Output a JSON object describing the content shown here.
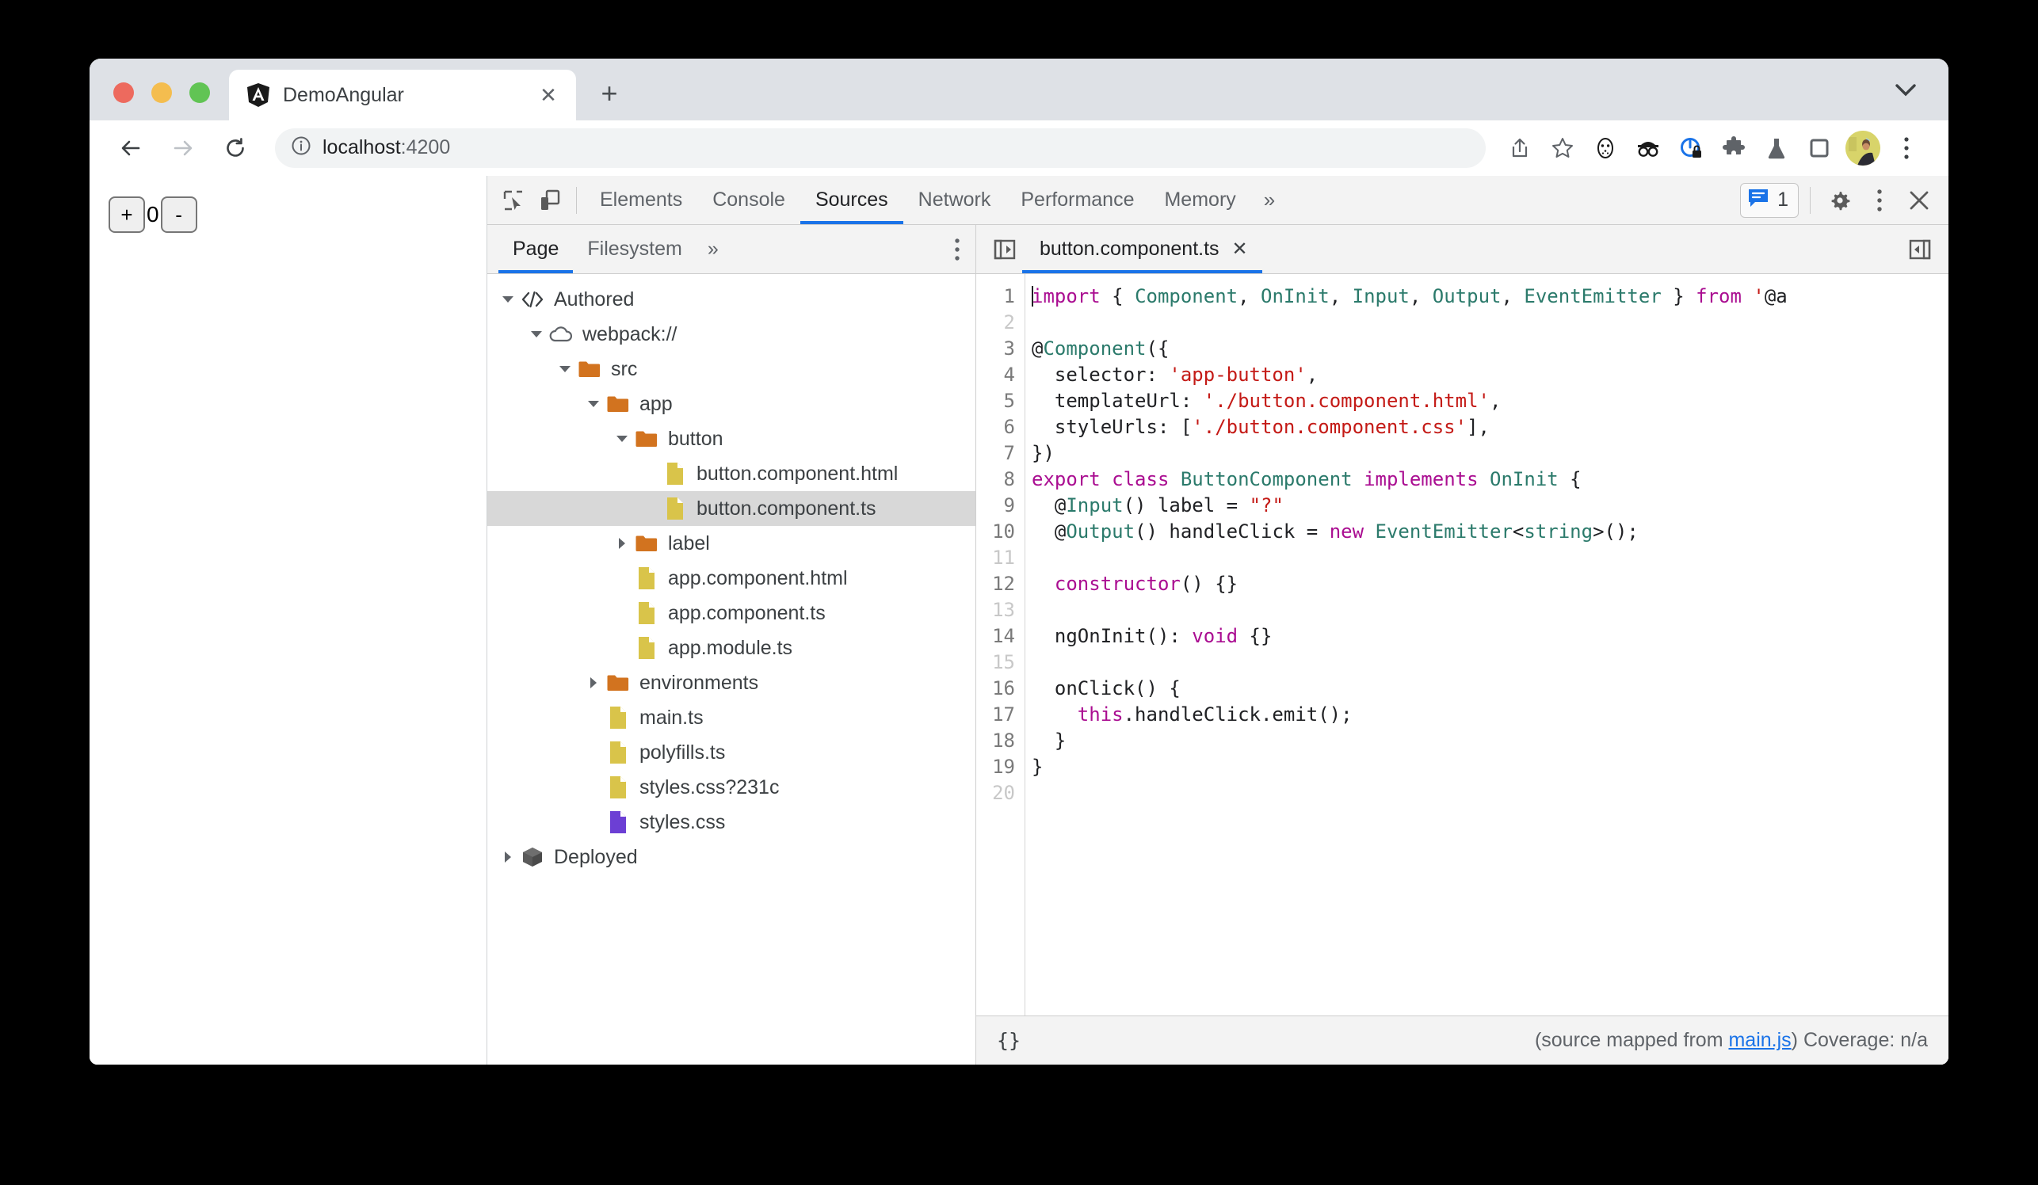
{
  "browser": {
    "tab": {
      "title": "DemoAngular",
      "favicon": "angular-icon",
      "close_label": "✕"
    },
    "new_tab_label": "+",
    "window_chevron": "chevron-down-icon",
    "nav": {
      "back": "←",
      "forward": "→",
      "reload": "⟳"
    },
    "omnibox": {
      "info_icon": "info-circle-icon",
      "url_host": "localhost",
      "url_port": ":4200"
    },
    "toolbar_icons": [
      "share-icon",
      "bookmark-star-icon",
      "mask-extension-icon",
      "incognito-glasses-extension-icon",
      "privacy-lock-extension-icon",
      "extensions-puzzle-icon",
      "flask-experiments-icon",
      "side-panel-icon"
    ],
    "avatar": "profile-avatar",
    "menu_icon": "three-dot-menu-icon"
  },
  "page": {
    "increment_label": "+",
    "counter_value": "0",
    "decrement_label": "-"
  },
  "devtools": {
    "inspect_icon": "inspect-element-icon",
    "device_icon": "device-toolbar-icon",
    "tabs": [
      {
        "label": "Elements",
        "active": false
      },
      {
        "label": "Console",
        "active": false
      },
      {
        "label": "Sources",
        "active": true
      },
      {
        "label": "Network",
        "active": false
      },
      {
        "label": "Performance",
        "active": false
      },
      {
        "label": "Memory",
        "active": false
      }
    ],
    "more_tabs_label": "»",
    "message_count": "1",
    "message_icon": "console-message-icon",
    "settings_icon": "gear-icon",
    "kebab_icon": "three-dot-menu-icon",
    "close_icon": "close-icon",
    "navigator": {
      "tabs": [
        {
          "label": "Page",
          "active": true
        },
        {
          "label": "Filesystem",
          "active": false
        }
      ],
      "more_label": "»",
      "kebab_icon": "three-dot-menu-icon",
      "tree": [
        {
          "label": "Authored",
          "icon": "code-brackets-icon",
          "depth": 0,
          "caret": "down",
          "selected": false
        },
        {
          "label": "webpack://",
          "icon": "cloud-icon",
          "depth": 1,
          "caret": "down",
          "selected": false
        },
        {
          "label": "src",
          "icon": "folder-icon",
          "depth": 2,
          "caret": "down",
          "selected": false
        },
        {
          "label": "app",
          "icon": "folder-icon",
          "depth": 3,
          "caret": "down",
          "selected": false
        },
        {
          "label": "button",
          "icon": "folder-icon",
          "depth": 4,
          "caret": "down",
          "selected": false
        },
        {
          "label": "button.component.html",
          "icon": "file-yellow-icon",
          "depth": 5,
          "caret": "none",
          "selected": false
        },
        {
          "label": "button.component.ts",
          "icon": "file-yellow-icon",
          "depth": 5,
          "caret": "none",
          "selected": true
        },
        {
          "label": "label",
          "icon": "folder-icon",
          "depth": 4,
          "caret": "right",
          "selected": false
        },
        {
          "label": "app.component.html",
          "icon": "file-yellow-icon",
          "depth": 4,
          "caret": "none",
          "selected": false
        },
        {
          "label": "app.component.ts",
          "icon": "file-yellow-icon",
          "depth": 4,
          "caret": "none",
          "selected": false
        },
        {
          "label": "app.module.ts",
          "icon": "file-yellow-icon",
          "depth": 4,
          "caret": "none",
          "selected": false
        },
        {
          "label": "environments",
          "icon": "folder-icon",
          "depth": 3,
          "caret": "right",
          "selected": false
        },
        {
          "label": "main.ts",
          "icon": "file-yellow-icon",
          "depth": 3,
          "caret": "none",
          "selected": false
        },
        {
          "label": "polyfills.ts",
          "icon": "file-yellow-icon",
          "depth": 3,
          "caret": "none",
          "selected": false
        },
        {
          "label": "styles.css?231c",
          "icon": "file-yellow-icon",
          "depth": 3,
          "caret": "none",
          "selected": false
        },
        {
          "label": "styles.css",
          "icon": "file-purple-icon",
          "depth": 3,
          "caret": "none",
          "selected": false
        },
        {
          "label": "Deployed",
          "icon": "cube-icon",
          "depth": 0,
          "caret": "right",
          "selected": false
        }
      ]
    },
    "source": {
      "left_toggle_icon": "show-navigator-icon",
      "right_toggle_icon": "show-debugger-icon",
      "open_file_tab": "button.component.ts",
      "open_file_close": "✕",
      "line_numbers": [
        "1",
        "2",
        "3",
        "4",
        "5",
        "6",
        "7",
        "8",
        "9",
        "10",
        "11",
        "12",
        "13",
        "14",
        "15",
        "16",
        "17",
        "18",
        "19",
        "20"
      ],
      "lines_with_code": [
        1,
        3,
        4,
        5,
        6,
        7,
        8,
        9,
        10,
        12,
        14,
        16,
        17,
        18,
        19
      ],
      "code_lines": [
        "import { Component, OnInit, Input, Output, EventEmitter } from '@a",
        "",
        "@Component({",
        "  selector: 'app-button',",
        "  templateUrl: './button.component.html',",
        "  styleUrls: ['./button.component.css'],",
        "})",
        "export class ButtonComponent implements OnInit {",
        "  @Input() label = \"?\"",
        "  @Output() handleClick = new EventEmitter<string>();",
        "",
        "  constructor() {}",
        "",
        "  ngOnInit(): void {}",
        "",
        "  onClick() {",
        "    this.handleClick.emit();",
        "  }",
        "}",
        ""
      ],
      "status": {
        "pretty_print_label": "{}",
        "source_mapped_prefix": "(source mapped from ",
        "source_mapped_link": "main.js",
        "source_mapped_suffix": ")",
        "coverage": "Coverage: n/a"
      }
    }
  },
  "colors": {
    "accent_blue": "#1a73e8",
    "tabstrip_bg": "#dee1e6",
    "devtools_header_bg": "#f3f3f3",
    "tree_selected_bg": "#d8d8d8",
    "folder_orange": "#d2731f",
    "file_yellow": "#d9c44a",
    "file_purple": "#6c3fd4",
    "syntax_keyword": "#aa0d91",
    "syntax_string": "#c41a16",
    "syntax_type": "#2b7a6b",
    "syntax_plain": "#202124"
  }
}
